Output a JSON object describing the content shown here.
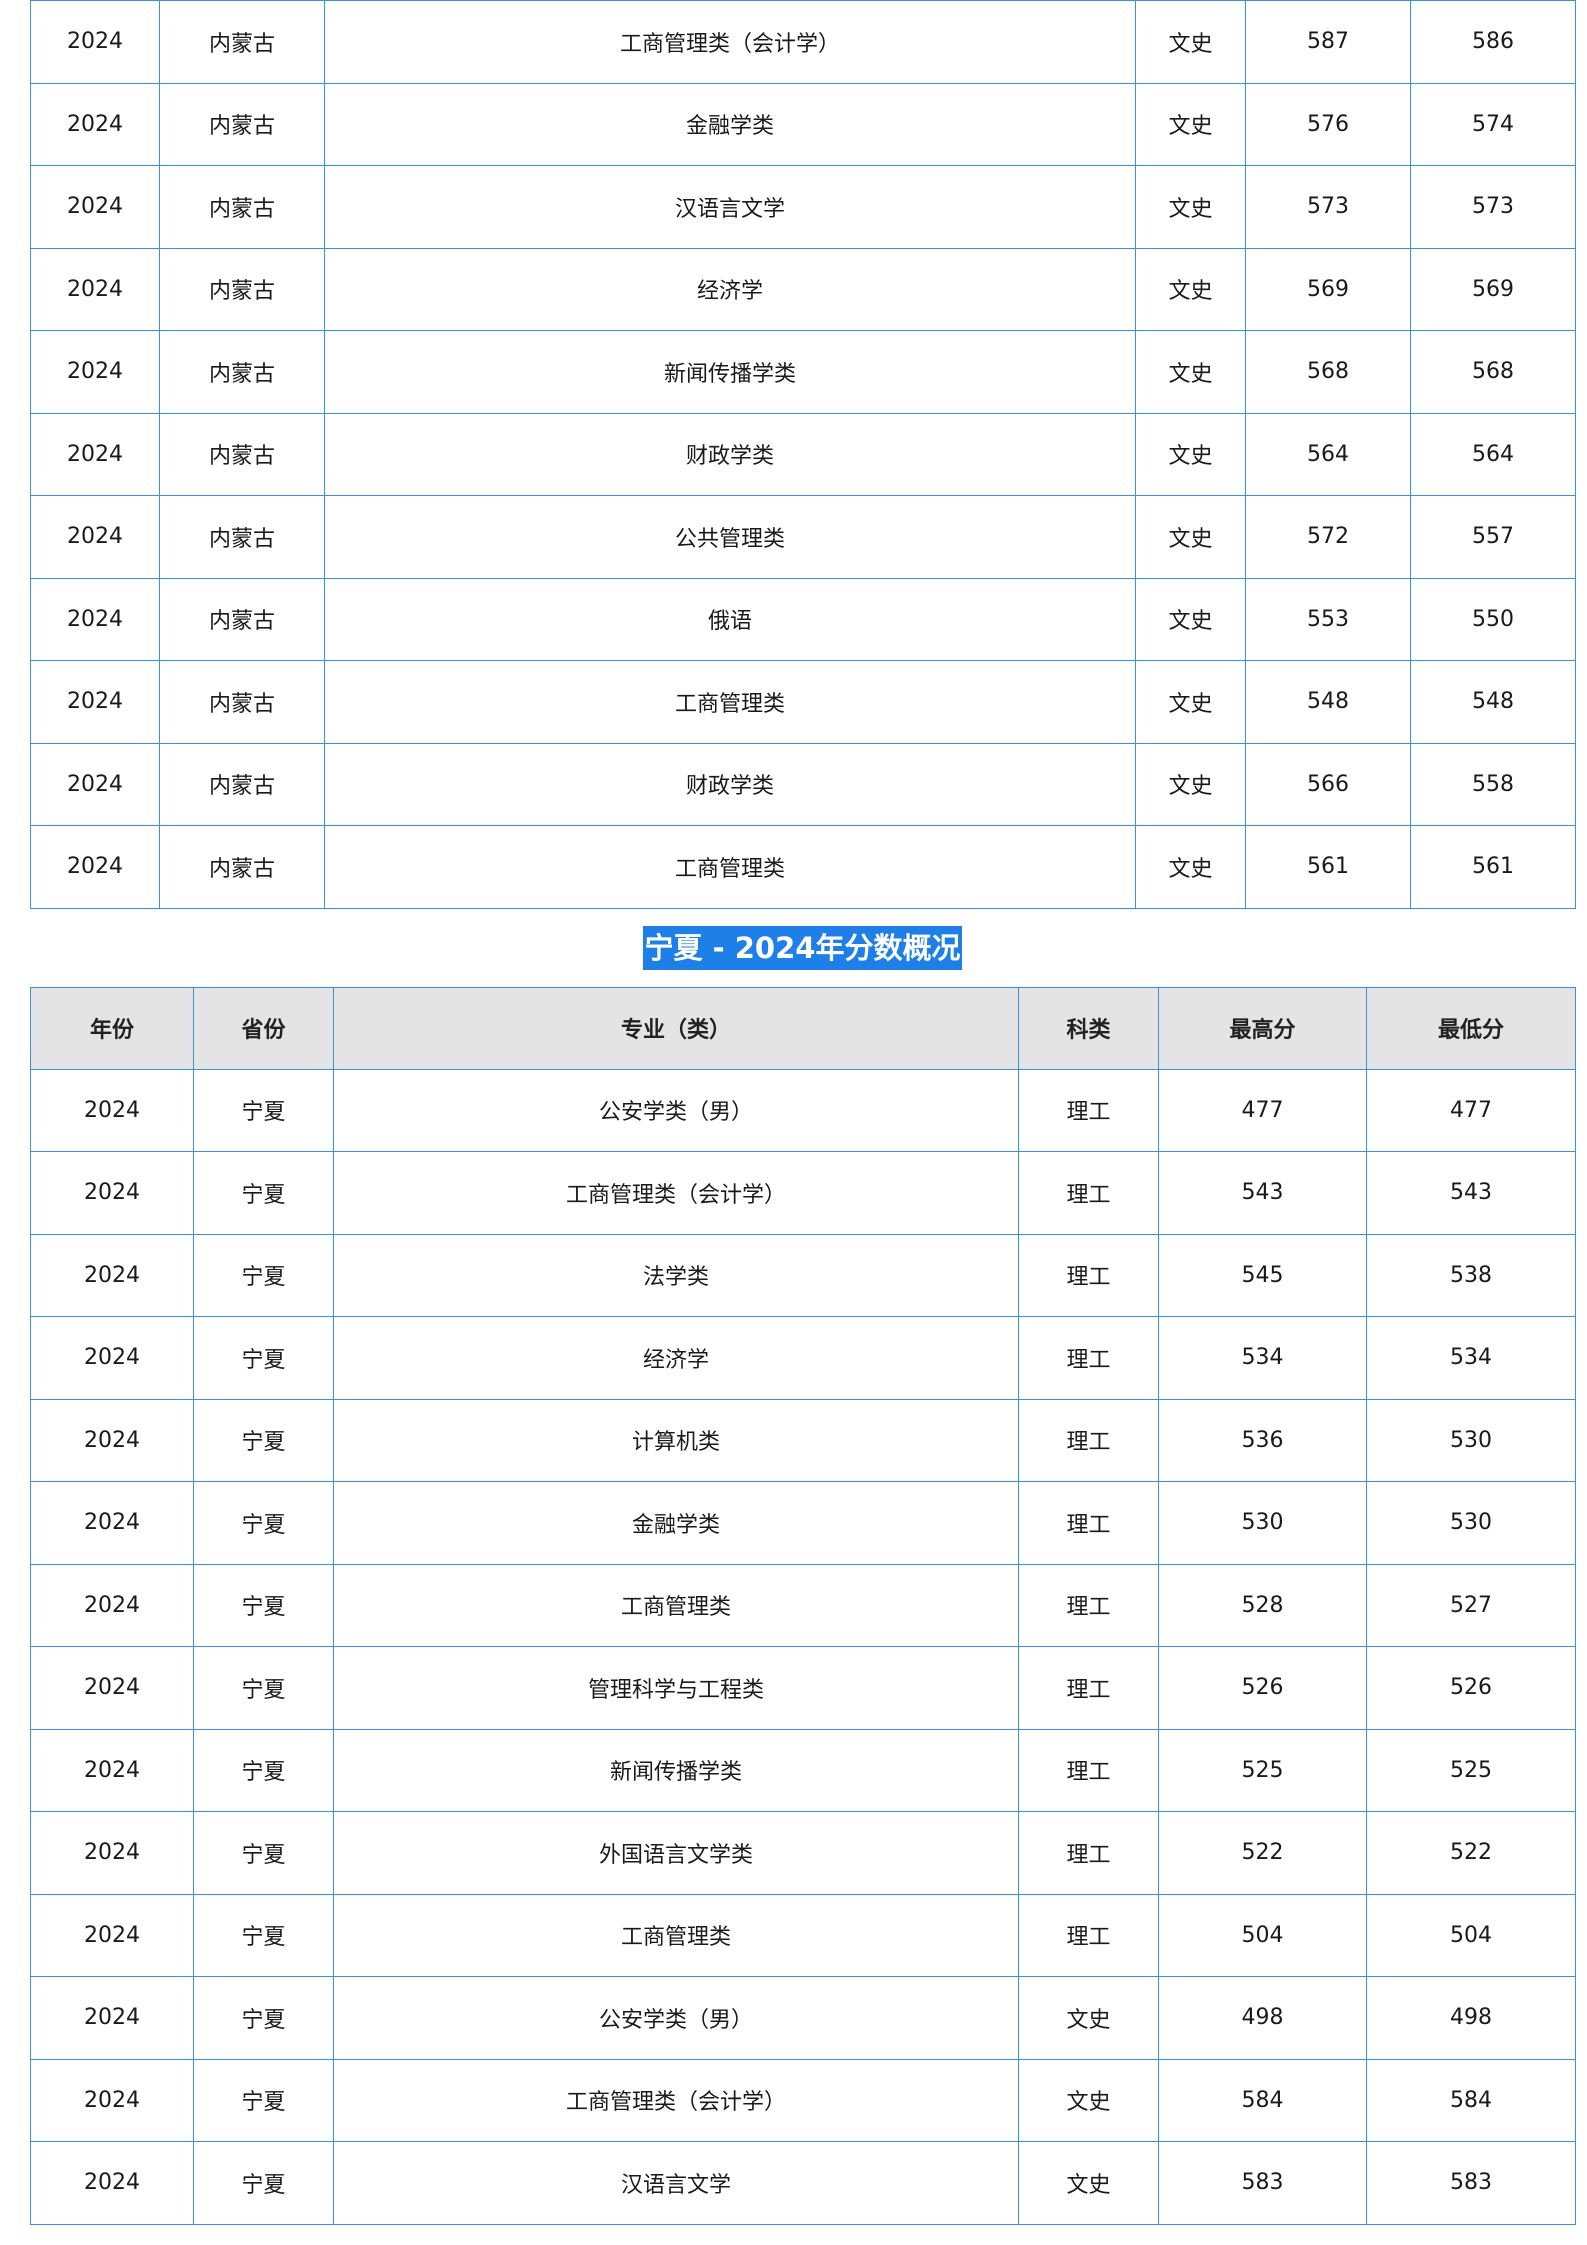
{
  "table1": {
    "rows": [
      [
        "2024",
        "内蒙古",
        "工商管理类（会计学）",
        "文史",
        "587",
        "586"
      ],
      [
        "2024",
        "内蒙古",
        "金融学类",
        "文史",
        "576",
        "574"
      ],
      [
        "2024",
        "内蒙古",
        "汉语言文学",
        "文史",
        "573",
        "573"
      ],
      [
        "2024",
        "内蒙古",
        "经济学",
        "文史",
        "569",
        "569"
      ],
      [
        "2024",
        "内蒙古",
        "新闻传播学类",
        "文史",
        "568",
        "568"
      ],
      [
        "2024",
        "内蒙古",
        "财政学类",
        "文史",
        "564",
        "564"
      ],
      [
        "2024",
        "内蒙古",
        "公共管理类",
        "文史",
        "572",
        "557"
      ],
      [
        "2024",
        "内蒙古",
        "俄语",
        "文史",
        "553",
        "550"
      ],
      [
        "2024",
        "内蒙古",
        "工商管理类",
        "文史",
        "548",
        "548"
      ],
      [
        "2024",
        "内蒙古",
        "财政学类",
        "文史",
        "566",
        "558"
      ],
      [
        "2024",
        "内蒙古",
        "工商管理类",
        "文史",
        "561",
        "561"
      ]
    ]
  },
  "section2": {
    "title": "宁夏 - 2024年分数概况"
  },
  "table2": {
    "headers": [
      "年份",
      "省份",
      "专业（类）",
      "科类",
      "最高分",
      "最低分"
    ],
    "rows": [
      [
        "2024",
        "宁夏",
        "公安学类（男）",
        "理工",
        "477",
        "477"
      ],
      [
        "2024",
        "宁夏",
        "工商管理类（会计学）",
        "理工",
        "543",
        "543"
      ],
      [
        "2024",
        "宁夏",
        "法学类",
        "理工",
        "545",
        "538"
      ],
      [
        "2024",
        "宁夏",
        "经济学",
        "理工",
        "534",
        "534"
      ],
      [
        "2024",
        "宁夏",
        "计算机类",
        "理工",
        "536",
        "530"
      ],
      [
        "2024",
        "宁夏",
        "金融学类",
        "理工",
        "530",
        "530"
      ],
      [
        "2024",
        "宁夏",
        "工商管理类",
        "理工",
        "528",
        "527"
      ],
      [
        "2024",
        "宁夏",
        "管理科学与工程类",
        "理工",
        "526",
        "526"
      ],
      [
        "2024",
        "宁夏",
        "新闻传播学类",
        "理工",
        "525",
        "525"
      ],
      [
        "2024",
        "宁夏",
        "外国语言文学类",
        "理工",
        "522",
        "522"
      ],
      [
        "2024",
        "宁夏",
        "工商管理类",
        "理工",
        "504",
        "504"
      ],
      [
        "2024",
        "宁夏",
        "公安学类（男）",
        "文史",
        "498",
        "498"
      ],
      [
        "2024",
        "宁夏",
        "工商管理类（会计学）",
        "文史",
        "584",
        "584"
      ],
      [
        "2024",
        "宁夏",
        "汉语言文学",
        "文史",
        "583",
        "583"
      ]
    ]
  }
}
